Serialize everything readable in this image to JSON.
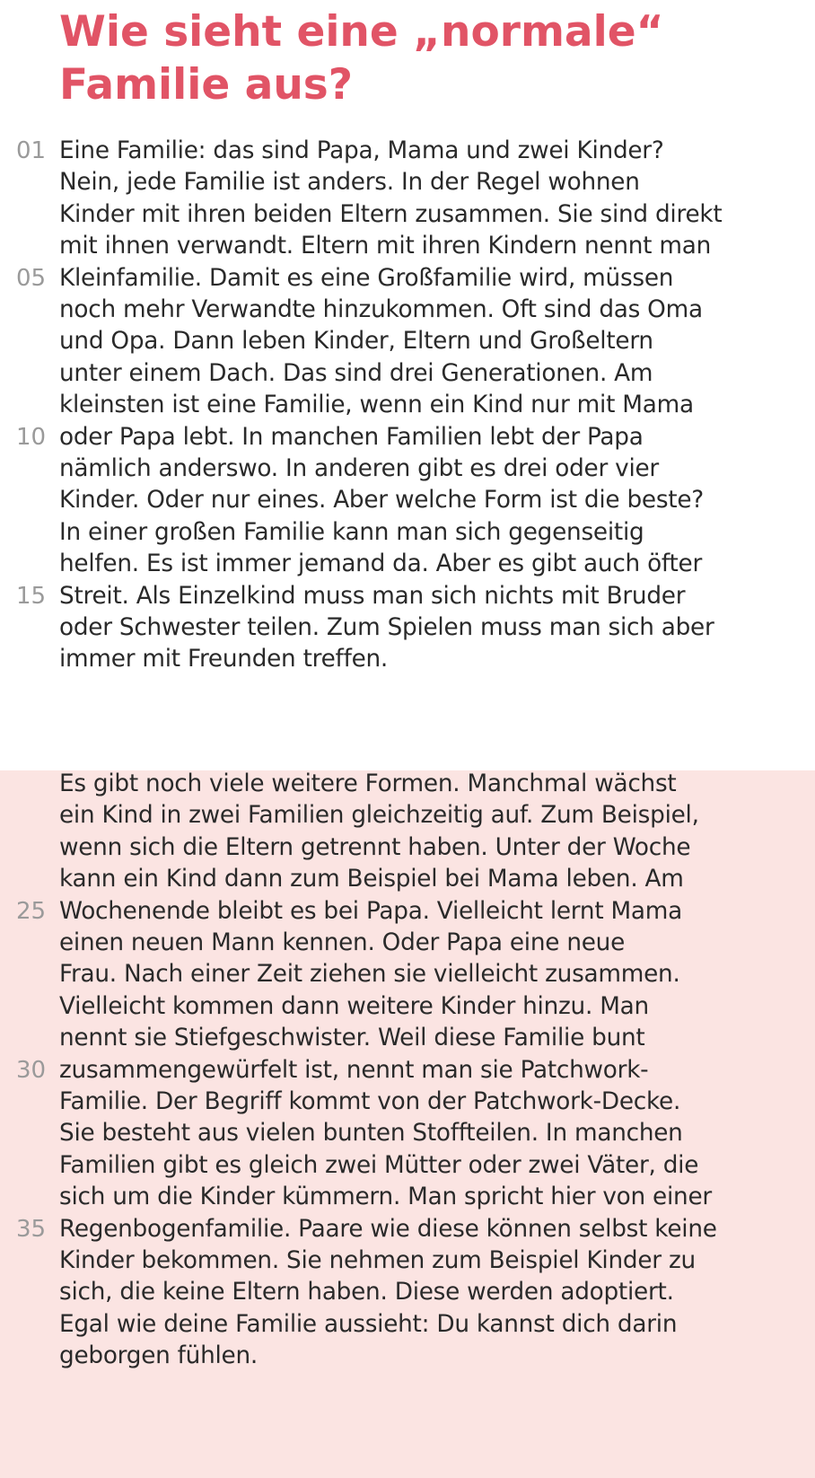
{
  "title": {
    "line1": "Wie sieht eine „normale“",
    "line2": "Familie aus?"
  },
  "section1": {
    "lines": [
      {
        "num": "01",
        "text": "Eine Familie: das sind Papa, Mama und zwei Kinder?"
      },
      {
        "num": "",
        "text": "Nein, jede Familie ist anders. In der Regel wohnen"
      },
      {
        "num": "",
        "text": "Kinder mit ihren beiden Eltern zusammen. Sie sind direkt"
      },
      {
        "num": "",
        "text": "mit ihnen verwandt. Eltern mit ihren Kindern nennt man"
      },
      {
        "num": "05",
        "text": "Kleinfamilie. Damit es eine Großfamilie wird, müssen"
      },
      {
        "num": "",
        "text": "noch mehr Verwandte hinzukommen. Oft sind das Oma"
      },
      {
        "num": "",
        "text": "und Opa. Dann leben Kinder, Eltern und Großeltern"
      },
      {
        "num": "",
        "text": "unter einem Dach. Das sind drei Generationen. Am"
      },
      {
        "num": "",
        "text": "kleinsten ist eine Familie, wenn ein Kind nur mit Mama"
      },
      {
        "num": "10",
        "text": "oder Papa lebt. In manchen Familien lebt der Papa"
      },
      {
        "num": "",
        "text": "nämlich anderswo. In anderen gibt es drei oder vier"
      },
      {
        "num": "",
        "text": "Kinder. Oder nur eines. Aber welche Form ist die beste?"
      },
      {
        "num": "",
        "text": "In einer großen Familie kann man sich gegenseitig"
      },
      {
        "num": "",
        "text": "helfen. Es ist immer jemand da. Aber es gibt auch öfter"
      },
      {
        "num": "15",
        "text": "Streit. Als Einzelkind muss man sich nichts mit Bruder"
      },
      {
        "num": "",
        "text": "oder Schwester teilen. Zum Spielen muss man sich aber"
      },
      {
        "num": "",
        "text": "immer mit Freunden treffen."
      }
    ]
  },
  "section2": {
    "lines": [
      {
        "num": "",
        "text": "Es gibt noch viele weitere Formen. Manchmal wächst"
      },
      {
        "num": "",
        "text": "ein Kind in zwei Familien gleichzeitig auf. Zum Beispiel,"
      },
      {
        "num": "",
        "text": "wenn sich die Eltern getrennt haben. Unter der Woche"
      },
      {
        "num": "",
        "text": "kann ein Kind dann zum Beispiel bei Mama leben. Am"
      },
      {
        "num": "25",
        "text": "Wochenende bleibt es bei Papa. Vielleicht lernt Mama"
      },
      {
        "num": "",
        "text": "einen neuen Mann kennen. Oder Papa eine neue"
      },
      {
        "num": "",
        "text": "Frau. Nach einer Zeit ziehen sie vielleicht zusammen."
      },
      {
        "num": "",
        "text": "Vielleicht kommen dann weitere Kinder hinzu. Man"
      },
      {
        "num": "",
        "text": "nennt sie Stiefgeschwister. Weil diese Familie bunt"
      },
      {
        "num": "30",
        "text": "zusammengewürfelt ist, nennt man sie Patchwork-"
      },
      {
        "num": "",
        "text": "Familie. Der Begriff kommt von der Patchwork-Decke."
      },
      {
        "num": "",
        "text": "Sie besteht aus vielen bunten Stoffteilen. In manchen"
      },
      {
        "num": "",
        "text": "Familien gibt es gleich zwei Mütter oder zwei Väter, die"
      },
      {
        "num": "",
        "text": "sich um die Kinder kümmern. Man spricht hier von einer"
      },
      {
        "num": "35",
        "text": "Regenbogenfamilie. Paare wie diese können selbst keine"
      },
      {
        "num": "",
        "text": "Kinder bekommen. Sie nehmen zum Beispiel Kinder zu"
      },
      {
        "num": "",
        "text": "sich, die keine Eltern haben. Diese werden adoptiert."
      },
      {
        "num": "",
        "text": "Egal wie deine Familie aussieht: Du kannst dich darin"
      },
      {
        "num": "",
        "text": "geborgen fühlen."
      }
    ]
  },
  "colors": {
    "title": "#e15466",
    "text": "#2a2a2a",
    "line_numbers": "#9a9a9a",
    "pink_background": "#fbe4e2"
  }
}
